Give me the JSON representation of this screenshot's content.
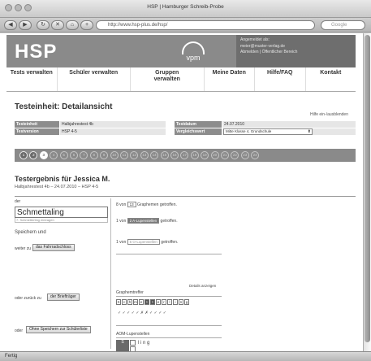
{
  "window": {
    "title": "HSP | Hamburger Schreib-Probe",
    "url": "http://www.hsp-plus.de/hsp/",
    "search_placeholder": "Google",
    "status": "Fertig"
  },
  "header": {
    "logo": "HSP",
    "brand": "vpm",
    "user_lines": [
      "Angemeldet als:",
      "meier@muster-verlag.de",
      "Abmelden | Öffentlicher Bereich"
    ]
  },
  "nav": {
    "items": [
      "Tests verwalten",
      "Schüler verwalten",
      "Gruppen verwalten",
      "Meine Daten",
      "Hilfe/FAQ",
      "Kontakt"
    ]
  },
  "detail": {
    "heading": "Testeinheit: Detailansicht",
    "help_toggle": "Hilfe ein-/ausblenden",
    "labels": {
      "testeinheit": "Testeinheit",
      "testversion": "Testversion",
      "testdatum": "Testdatum",
      "vergleichswert": "Vergleichswert"
    },
    "values": {
      "testeinheit": "Halbjahrestest 4b",
      "testversion": "HSP 4-5",
      "testdatum": "24.07.2010",
      "vergleichswert": "Mitte Klasse 4, Grundschule"
    }
  },
  "progress": {
    "items": [
      "1",
      "2",
      "3",
      "4",
      "5",
      "6",
      "7",
      "8",
      "9",
      "10",
      "11",
      "12",
      "13",
      "14",
      "15",
      "16",
      "17",
      "18",
      "19",
      "20",
      "21",
      "22",
      "23",
      "24"
    ],
    "done_count": 2,
    "current_index": 2
  },
  "result": {
    "heading": "Testergebnis für Jessica M.",
    "subline": "Halbjahrestest 4b – 24.07.2010 – HSP 4-5"
  },
  "left": {
    "article": "der",
    "word": "Schmettaling",
    "hint": "7. Schmetterling eintragen",
    "save_heading": "Speichern und",
    "next_prefix": "weiter zu",
    "next_button": "das Fahrradschloss",
    "back_prefix": "oder zurück zu",
    "back_button": "der Briefträger",
    "or_label": "oder",
    "list_button": "Ohne Speichern zur Schülerliste"
  },
  "right": {
    "line1_prefix": "8 von",
    "line1_value": "13",
    "line1_suffix": "Graphemen getroffen.",
    "line2_prefix": "1 von",
    "line2_value": "2 A-Lupenstellen",
    "line2_suffix": "getroffen.",
    "line3_prefix": "1 von",
    "line3_value": "5 O-Lupenstellen",
    "line3_suffix": "getroffen.",
    "details_toggle": "Details anzeigen",
    "graphem_title": "Graphemtreffer",
    "graphemes": [
      "S",
      "c",
      "h",
      "m",
      "e",
      "t",
      "t",
      "e",
      "r",
      "l",
      "i",
      "n",
      "g"
    ],
    "checks": "✓ ✓ ✓ ✓ ✓ ✗ ✗ ✓ ✓ ✓ ✓",
    "aom_title": "AOM-Lupenstellen",
    "aom_rest": "l i n g"
  }
}
